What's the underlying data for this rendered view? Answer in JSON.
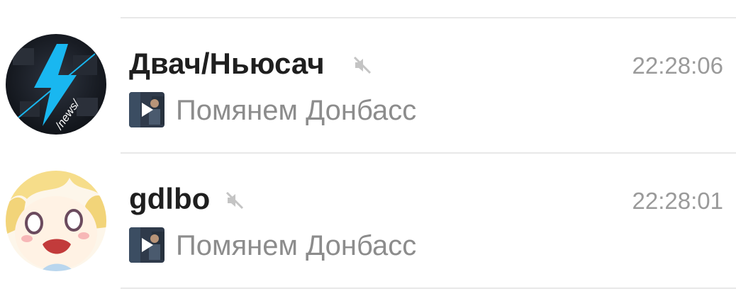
{
  "chats": [
    {
      "name": "Двач/Ньюсач",
      "muted": true,
      "time": "22:28:06",
      "preview_media": "video-icon",
      "preview": "Помянем Донбасс",
      "avatar_icon": "lightning-icon",
      "avatar_text": "/news/"
    },
    {
      "name": "gdlbo",
      "muted": true,
      "time": "22:28:01",
      "preview_media": "video-icon",
      "preview": "Помянем Донбасс",
      "avatar_icon": "anime-face-icon"
    }
  ],
  "colors": {
    "name": "#1f1f1f",
    "time": "#9a9a9a",
    "preview": "#8c8c8c",
    "divider": "#e8e8e8",
    "accent_lightning": "#19b7f0"
  }
}
